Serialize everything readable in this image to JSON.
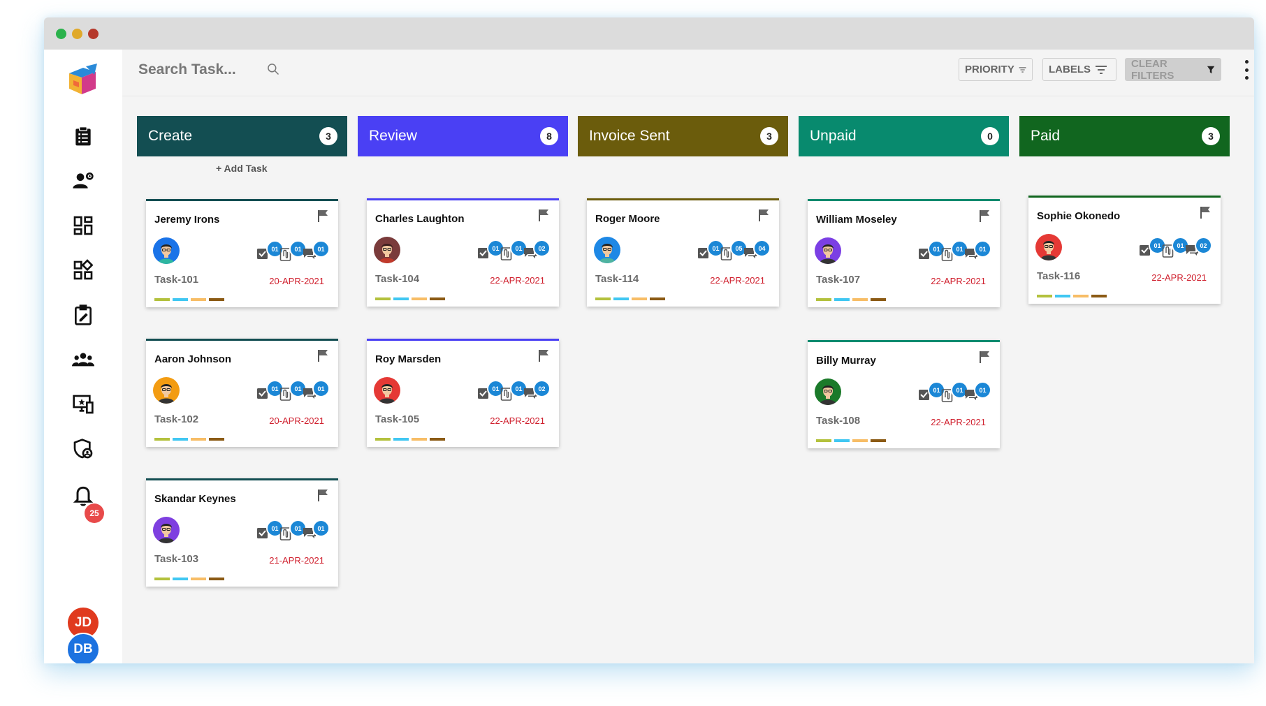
{
  "search": {
    "placeholder": "Search Task..."
  },
  "filters": {
    "priority": "PRIORITY",
    "labels": "LABELS",
    "clear": "CLEAR FILTERS"
  },
  "notifications": {
    "count": "25"
  },
  "users": [
    "JD",
    "DB"
  ],
  "add_task_label": "+ Add Task",
  "colors": {
    "create": "#134e52",
    "review": "#4a40f4",
    "invoice_sent": "#6b5c0c",
    "unpaid": "#088a6e",
    "paid": "#11661f",
    "date": "#d0202e",
    "badge": "#1b87d6",
    "label_colors": [
      "#b3c13d",
      "#40c7f2",
      "#f7bd66",
      "#8b5a14"
    ]
  },
  "columns": [
    {
      "title": "Create",
      "count": "3",
      "cards": [
        {
          "name": "Jeremy Irons",
          "task": "Task-101",
          "date": "20-APR-2021",
          "checks": "01",
          "attachments": "01",
          "comments": "01"
        },
        {
          "name": "Aaron Johnson",
          "task": "Task-102",
          "date": "20-APR-2021",
          "checks": "01",
          "attachments": "01",
          "comments": "01"
        },
        {
          "name": "Skandar Keynes",
          "task": "Task-103",
          "date": "21-APR-2021",
          "checks": "01",
          "attachments": "01",
          "comments": "01"
        }
      ]
    },
    {
      "title": "Review",
      "count": "8",
      "cards": [
        {
          "name": "Charles Laughton",
          "task": "Task-104",
          "date": "22-APR-2021",
          "checks": "01",
          "attachments": "01",
          "comments": "02"
        },
        {
          "name": "Roy Marsden",
          "task": "Task-105",
          "date": "22-APR-2021",
          "checks": "01",
          "attachments": "01",
          "comments": "02"
        }
      ]
    },
    {
      "title": "Invoice Sent",
      "count": "3",
      "cards": [
        {
          "name": "Roger Moore",
          "task": "Task-114",
          "date": "22-APR-2021",
          "checks": "01",
          "attachments": "05",
          "comments": "04"
        }
      ]
    },
    {
      "title": "Unpaid",
      "count": "0",
      "cards": [
        {
          "name": "William Moseley",
          "task": "Task-107",
          "date": "22-APR-2021",
          "checks": "01",
          "attachments": "01",
          "comments": "01"
        },
        {
          "name": "Billy Murray",
          "task": "Task-108",
          "date": "22-APR-2021",
          "checks": "01",
          "attachments": "01",
          "comments": "01"
        }
      ]
    },
    {
      "title": "Paid",
      "count": "3",
      "cards": [
        {
          "name": "Sophie Okonedo",
          "task": "Task-116",
          "date": "22-APR-2021",
          "checks": "01",
          "attachments": "01",
          "comments": "02"
        }
      ]
    }
  ]
}
